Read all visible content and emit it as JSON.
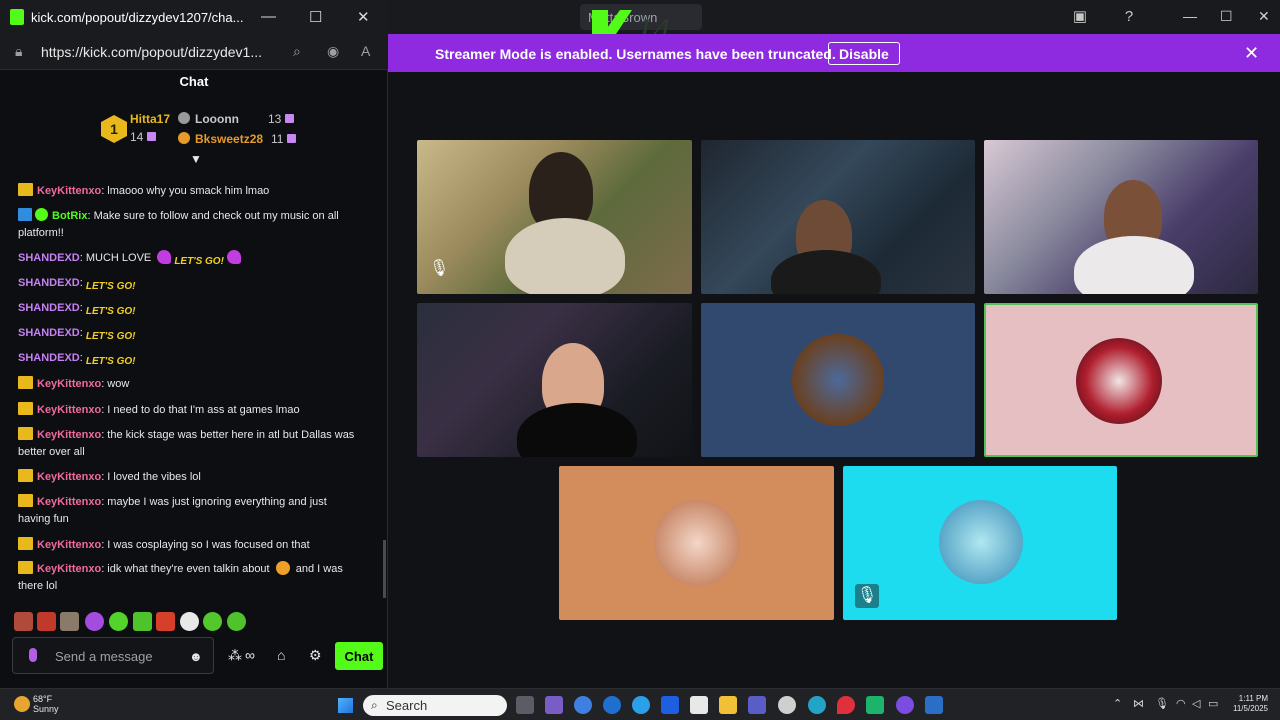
{
  "popout": {
    "title": "kick.com/popout/dizzydev1207/cha...",
    "url": "https://kick.com/popout/dizzydev1...",
    "chat_header": "Chat",
    "leaderboard": {
      "rank": "1",
      "items": [
        {
          "name": "Hitta17",
          "count": "14",
          "color": "#e9b81c"
        },
        {
          "name": "Looonn",
          "count": "13",
          "color": "#c8c8c8"
        },
        {
          "name": "Bksweetz28",
          "count": "11",
          "color": "#e59a2a"
        }
      ]
    },
    "messages": [
      {
        "user": "KeyKittenxo",
        "text": ": lmaooo why you smack him lmao"
      },
      {
        "user": "BotRix",
        "text": ": Make sure to follow and check out my music on all",
        "text2": "platform!!"
      },
      {
        "user": "SHANDEXD",
        "text": ": MUCH LOVE"
      },
      {
        "user": "SHANDEXD",
        "text": ":"
      },
      {
        "user": "SHANDEXD",
        "text": ":"
      },
      {
        "user": "SHANDEXD",
        "text": ":"
      },
      {
        "user": "SHANDEXD",
        "text": ":"
      },
      {
        "user": "KeyKittenxo",
        "text": ": wow"
      },
      {
        "user": "KeyKittenxo",
        "text": ": I need to do that I'm ass at games lmao"
      },
      {
        "user": "KeyKittenxo",
        "text": ": the kick stage was better here in atl but Dallas was",
        "text2": "better over all"
      },
      {
        "user": "KeyKittenxo",
        "text": ": I loved the vibes lol"
      },
      {
        "user": "KeyKittenxo",
        "text": ": maybe I was just ignoring everything and just",
        "text2": "having fun"
      },
      {
        "user": "KeyKittenxo",
        "text": ": I was cosplaying so I was focused on that"
      },
      {
        "user": "KeyKittenxo",
        "text": ": idk what they're even talkin about",
        "text2": "there lol",
        "mid": "and I was"
      }
    ],
    "emote_label": "LET'S GO!",
    "input_placeholder": "Send a message",
    "chat_button": "Chat"
  },
  "banner": {
    "text": "Streamer Mode is enabled. Usernames have been truncated.",
    "button": "Disable"
  },
  "top": {
    "tab_label": "MuttaBrown",
    "k14": "14"
  },
  "taskbar": {
    "temp": "68°F",
    "weather": "Sunny",
    "search": "Search",
    "time": "1:11 PM",
    "date": "11/5/2025"
  },
  "icons": {
    "mute": "mic-off-icon",
    "close": "close-icon",
    "help": "help-icon"
  },
  "colors": {
    "kick_green": "#53fc18",
    "banner": "#8e2be0",
    "active_border": "#53c25a"
  }
}
